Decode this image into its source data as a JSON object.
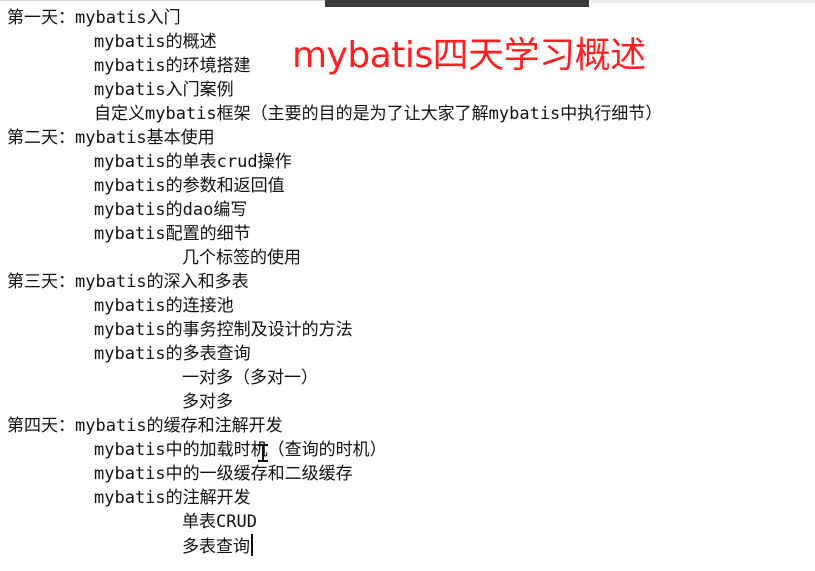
{
  "overlay_title": "mybatis四天学习概述",
  "outline": {
    "day1": {
      "title": "第一天：mybatis入门",
      "items": [
        "mybatis的概述",
        "mybatis的环境搭建",
        "mybatis入门案例",
        "自定义mybatis框架（主要的目的是为了让大家了解mybatis中执行细节）"
      ]
    },
    "day2": {
      "title": "第二天：mybatis基本使用",
      "items": [
        "mybatis的单表crud操作",
        "mybatis的参数和返回值",
        "mybatis的dao编写",
        "mybatis配置的细节"
      ],
      "subitems": [
        "几个标签的使用"
      ]
    },
    "day3": {
      "title": "第三天：mybatis的深入和多表",
      "items": [
        "mybatis的连接池",
        "mybatis的事务控制及设计的方法",
        "mybatis的多表查询"
      ],
      "subitems": [
        "一对多（多对一）",
        "多对多"
      ]
    },
    "day4": {
      "title": "第四天：mybatis的缓存和注解开发",
      "items": [
        "mybatis中的加载时机（查询的时机）",
        "mybatis中的一级缓存和二级缓存",
        "mybatis的注解开发"
      ],
      "subitems": [
        "单表CRUD",
        "多表查询"
      ]
    }
  },
  "colors": {
    "overlay_title": "#ff1f1f",
    "text": "#111111",
    "background": "#ffffff"
  }
}
